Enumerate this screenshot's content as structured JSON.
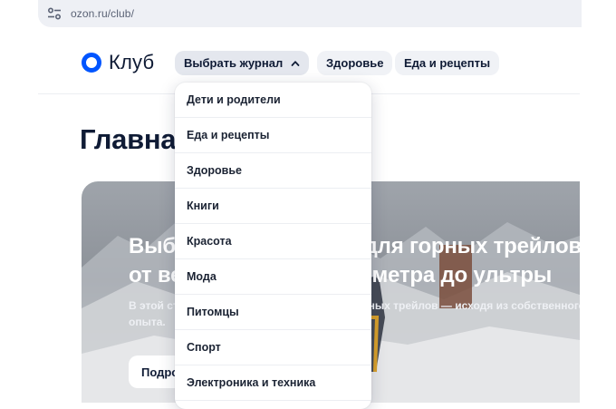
{
  "browser": {
    "url": "ozon.ru/club/"
  },
  "header": {
    "logo_text": "Клуб",
    "nav": [
      {
        "label": "Выбрать журнал",
        "expanded": true
      },
      {
        "label": "Здоровье"
      },
      {
        "label": "Еда и рецепты"
      }
    ]
  },
  "dropdown": {
    "items": [
      "Дети и родители",
      "Еда и рецепты",
      "Здоровье",
      "Книги",
      "Красота",
      "Мода",
      "Питомцы",
      "Спорт",
      "Электроника и техника"
    ]
  },
  "main": {
    "title": "Главная",
    "hero": {
      "line1": "Выбираем кроссовки для горных трейлов —",
      "line2": "от вертикального километра до ультры",
      "sub1": "В этой статье подбираем кроссовки для горных трейлов — исходя из собственного",
      "sub2": "опыта.",
      "button": "Подробнее"
    }
  },
  "colors": {
    "brand": "#0055ff",
    "text": "#0f1b35",
    "pill_bg": "#f0f2f6"
  }
}
